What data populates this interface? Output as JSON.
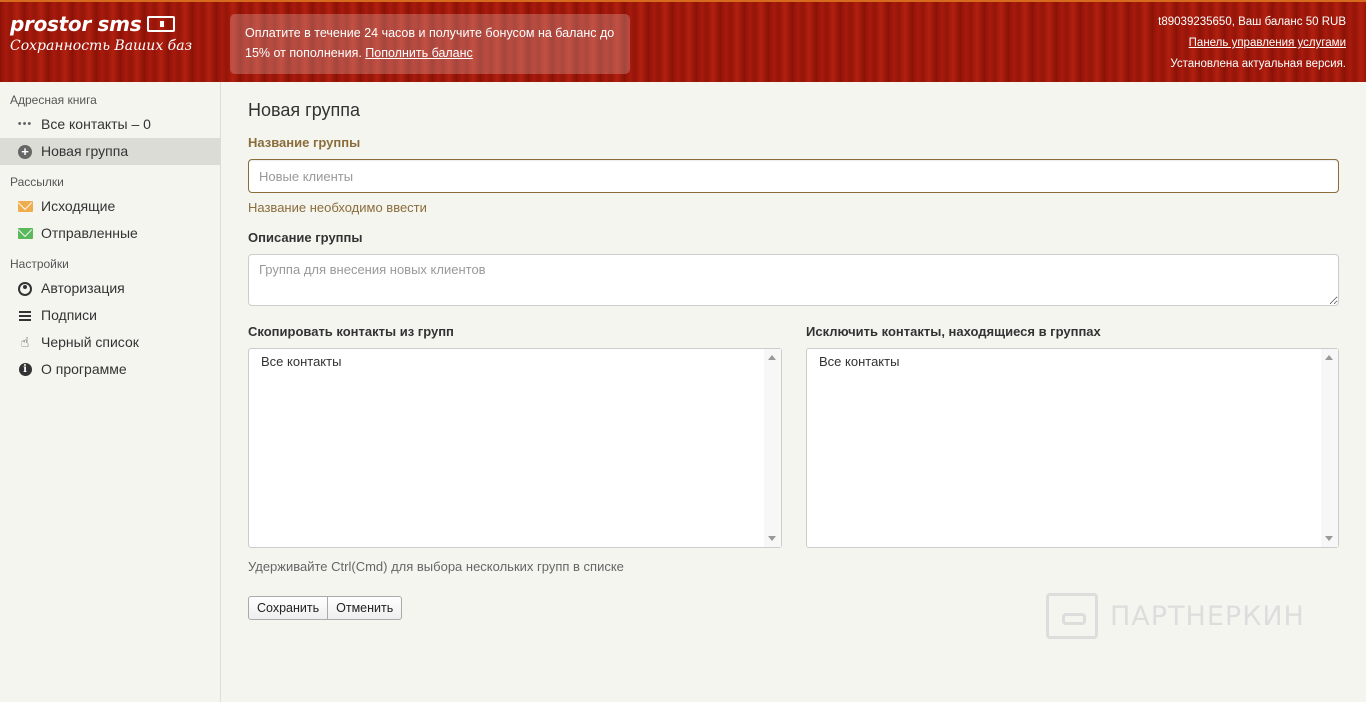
{
  "header": {
    "brand": "prostor sms",
    "tagline": "Сохранность Ваших баз",
    "promo_text": "Оплатите в течение 24 часов и получите бонусом на баланс до 15% от пополнения.",
    "promo_link": "Пополнить баланс",
    "account_info": "t89039235650, Ваш баланс 50 RUB",
    "control_panel_link": "Панель управления услугами",
    "version_status": "Установлена актуальная версия."
  },
  "sidebar": {
    "address_book": {
      "heading": "Адресная книга",
      "items": [
        {
          "label": "Все контакты – 0",
          "icon": "dots-icon",
          "active": false
        },
        {
          "label": "Новая группа",
          "icon": "plus-circle-icon",
          "active": true
        }
      ]
    },
    "mailings": {
      "heading": "Рассылки",
      "items": [
        {
          "label": "Исходящие",
          "icon": "envelope-icon",
          "color": "#f0ad4e"
        },
        {
          "label": "Отправленные",
          "icon": "envelope-icon",
          "color": "#5cb85c"
        }
      ]
    },
    "settings": {
      "heading": "Настройки",
      "items": [
        {
          "label": "Авторизация",
          "icon": "user-circle-icon"
        },
        {
          "label": "Подписи",
          "icon": "bars-icon"
        },
        {
          "label": "Черный список",
          "icon": "hand-icon"
        },
        {
          "label": "О программе",
          "icon": "info-circle-icon"
        }
      ]
    }
  },
  "form": {
    "title": "Новая группа",
    "name_label": "Название группы",
    "name_placeholder": "Новые клиенты",
    "name_error": "Название необходимо ввести",
    "description_label": "Описание группы",
    "description_placeholder": "Группа для внесения новых клиентов",
    "copy_label": "Скопировать контакты из групп",
    "copy_options": [
      "Все контакты"
    ],
    "exclude_label": "Исключить контакты, находящиеся в группах",
    "exclude_options": [
      "Все контакты"
    ],
    "hint": "Удерживайте Ctrl(Cmd) для выбора нескольких групп в списке",
    "save_label": "Сохранить",
    "cancel_label": "Отменить"
  },
  "watermark": {
    "text": "ПАРТНЕРКИН"
  },
  "colors": {
    "header_red": "#a81a0c",
    "warning_brown": "#8a6d3b",
    "outgoing_orange": "#f0ad4e",
    "sent_green": "#5cb85c"
  }
}
